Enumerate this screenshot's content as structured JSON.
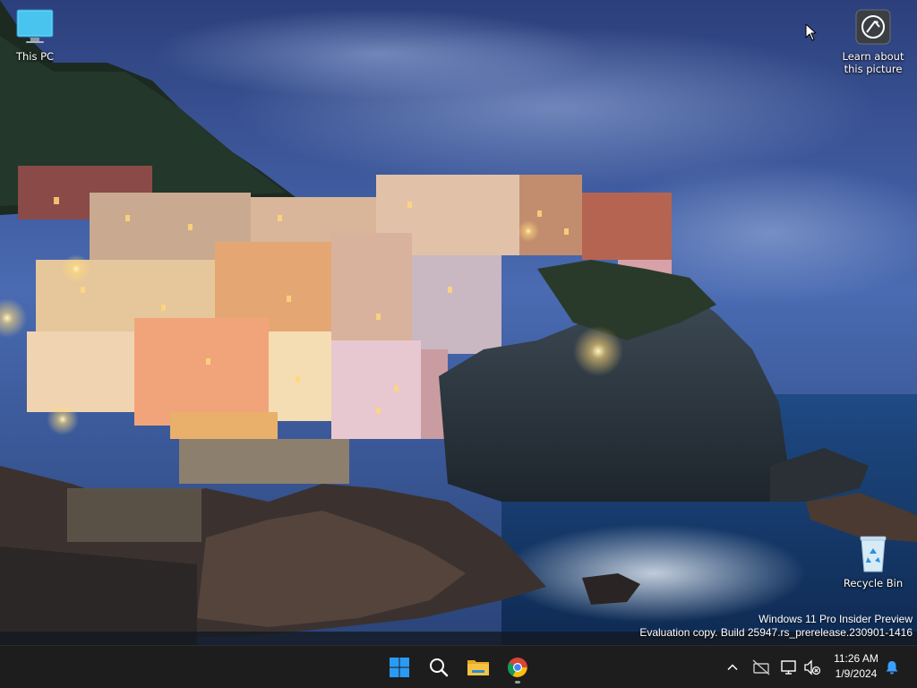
{
  "desktop": {
    "icons": [
      {
        "id": "this-pc",
        "label": "This PC",
        "icon": "monitor-icon"
      },
      {
        "id": "learn-about-picture",
        "label": "Learn about\nthis picture",
        "icon": "camera-info-icon"
      },
      {
        "id": "recycle-bin",
        "label": "Recycle Bin",
        "icon": "recycle-bin-icon"
      }
    ],
    "watermark": {
      "line1": "Windows 11 Pro Insider Preview",
      "line2": "Evaluation copy. Build 25947.rs_prerelease.230901-1416"
    }
  },
  "taskbar": {
    "pinned": [
      {
        "name": "start",
        "icon": "windows-logo-icon"
      },
      {
        "name": "search",
        "icon": "search-icon"
      },
      {
        "name": "file-explorer",
        "icon": "folder-icon"
      },
      {
        "name": "chrome",
        "icon": "chrome-icon",
        "running": true
      }
    ],
    "tray": {
      "icons": [
        "chevron-up-icon",
        "network-offline-icon",
        "display-icon",
        "volume-muted-icon",
        "notification-bell-icon"
      ],
      "time": "11:26 AM",
      "date": "1/9/2024"
    }
  },
  "colors": {
    "taskbar_bg": "#1d1d1d",
    "start_blue": "#2b9af3",
    "folder_yellow": "#f5c342",
    "bell_blue": "#3aa0ff"
  }
}
